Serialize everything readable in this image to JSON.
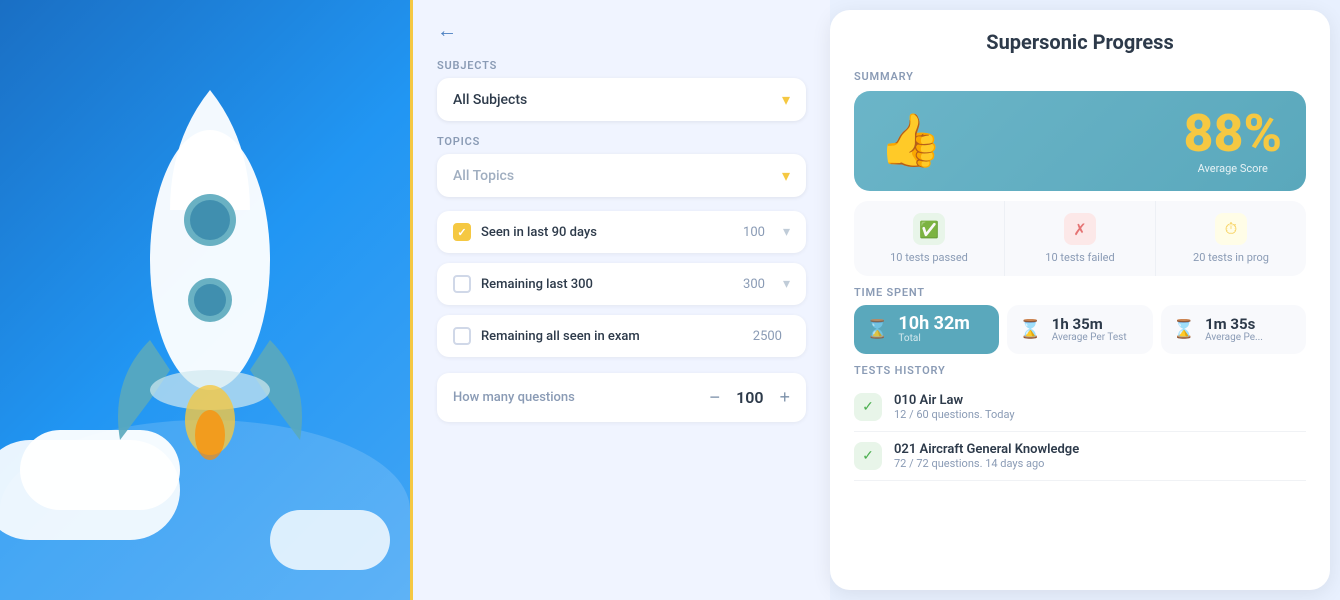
{
  "left": {
    "alt": "Rocket illustration"
  },
  "middle": {
    "back_icon": "←",
    "subjects_label": "Subjects",
    "subjects_value": "All Subjects",
    "subjects_chevron": "▾",
    "topics_label": "Topics",
    "topics_placeholder": "All Topics",
    "topics_chevron": "▾",
    "filter1_label": "Seen in last 90 days",
    "filter1_count": "100",
    "filter1_checked": true,
    "filter2_label": "Remaining last 300",
    "filter2_count": "300",
    "filter2_checked": false,
    "filter3_label": "Remaining all seen in exam",
    "filter3_count": "2500",
    "filter3_checked": false,
    "questions_label": "How many questions",
    "questions_minus": "−",
    "questions_value": "100",
    "questions_plus": "+"
  },
  "right": {
    "title": "Supersonic Progress",
    "summary_label": "SUMMARY",
    "score_value": "88%",
    "score_sub": "Average Score",
    "thumbs_emoji": "👍",
    "tests_passed_label": "10 tests passed",
    "tests_failed_label": "10 tests failed",
    "tests_inprog_label": "20 tests in prog",
    "time_spent_label": "TIME SPENT",
    "total_time": "10h 32m",
    "total_sub": "Total",
    "avg_per_test": "1h 35m",
    "avg_per_test_sub": "Average Per Test",
    "avg_per_q": "1m 35s",
    "avg_per_q_sub": "Average Pe...",
    "history_label": "TESTS HISTORY",
    "history_items": [
      {
        "title": "010 Air Law",
        "sub": "12 / 60 questions. Today"
      },
      {
        "title": "021 Aircraft General Knowledge",
        "sub": "72 / 72 questions. 14 days ago"
      }
    ]
  }
}
